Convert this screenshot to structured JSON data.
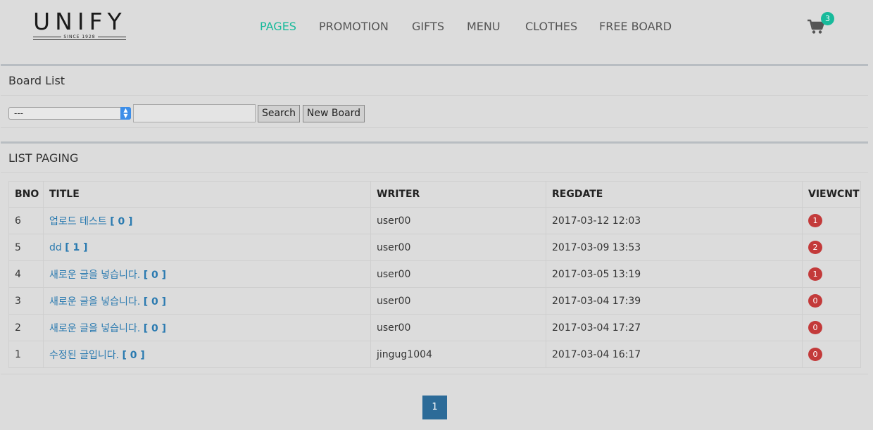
{
  "header": {
    "logo_text": "UNIFY",
    "logo_since": "SINCE 1928",
    "nav": [
      "PAGES",
      "PROMOTION",
      "GIFTS",
      "MENU",
      "CLOTHES",
      "FREE BOARD"
    ],
    "active_nav": "PAGES",
    "cart_icon": "shopping-cart-icon",
    "cart_count": "3"
  },
  "board_list": {
    "title": "Board List",
    "select_value": "---",
    "search_value": "",
    "search_label": "Search",
    "new_board_label": "New Board"
  },
  "list_paging": {
    "title": "LIST PAGING",
    "columns": [
      "BNO",
      "TITLE",
      "WRITER",
      "REGDATE",
      "VIEWCNT"
    ],
    "rows": [
      {
        "bno": "6",
        "title": "업로드 테스트",
        "replies": "[ 0 ]",
        "writer": "user00",
        "regdate": "2017-03-12 12:03",
        "viewcnt": "1"
      },
      {
        "bno": "5",
        "title": "dd",
        "replies": "[ 1 ]",
        "writer": "user00",
        "regdate": "2017-03-09 13:53",
        "viewcnt": "2"
      },
      {
        "bno": "4",
        "title": "새로운 글을 넣습니다.",
        "replies": "[ 0 ]",
        "writer": "user00",
        "regdate": "2017-03-05 13:19",
        "viewcnt": "1"
      },
      {
        "bno": "3",
        "title": "새로운 글을 넣습니다.",
        "replies": "[ 0 ]",
        "writer": "user00",
        "regdate": "2017-03-04 17:39",
        "viewcnt": "0"
      },
      {
        "bno": "2",
        "title": "새로운 글을 넣습니다.",
        "replies": "[ 0 ]",
        "writer": "user00",
        "regdate": "2017-03-04 17:27",
        "viewcnt": "0"
      },
      {
        "bno": "1",
        "title": "수정된 글입니다.",
        "replies": "[ 0 ]",
        "writer": "jingug1004",
        "regdate": "2017-03-04 16:17",
        "viewcnt": "0"
      }
    ]
  },
  "pagination": {
    "pages": [
      "1"
    ],
    "current": "1"
  },
  "colors": {
    "accent": "#18ba9b",
    "link": "#2a7ab0",
    "badge": "#c33a3a",
    "pager": "#2c6b98"
  }
}
